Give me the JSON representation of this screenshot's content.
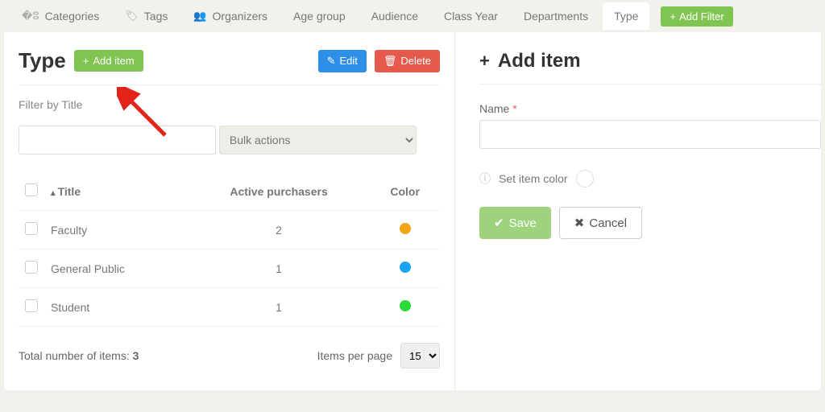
{
  "tabs": [
    {
      "label": "Categories"
    },
    {
      "label": "Tags"
    },
    {
      "label": "Organizers"
    },
    {
      "label": "Age group"
    },
    {
      "label": "Audience"
    },
    {
      "label": "Class Year"
    },
    {
      "label": "Departments"
    },
    {
      "label": "Type"
    }
  ],
  "add_filter_label": "Add Filter",
  "left": {
    "title": "Type",
    "add_item_label": "Add item",
    "edit_label": "Edit",
    "delete_label": "Delete",
    "filter_label": "Filter by Title",
    "bulk_actions_label": "Bulk actions",
    "columns": {
      "title": "Title",
      "active": "Active purchasers",
      "color": "Color"
    },
    "rows": [
      {
        "title": "Faculty",
        "active": "2",
        "color": "#f2a516"
      },
      {
        "title": "General Public",
        "active": "1",
        "color": "#1aa5f2"
      },
      {
        "title": "Student",
        "active": "1",
        "color": "#29dc3a"
      }
    ],
    "total_label": "Total number of items:",
    "total_value": "3",
    "items_per_page_label": "Items per page",
    "items_per_page_value": "15"
  },
  "right": {
    "title": "Add item",
    "name_label": "Name",
    "required_mark": "*",
    "set_color_label": "Set item color",
    "save_label": "Save",
    "cancel_label": "Cancel"
  }
}
